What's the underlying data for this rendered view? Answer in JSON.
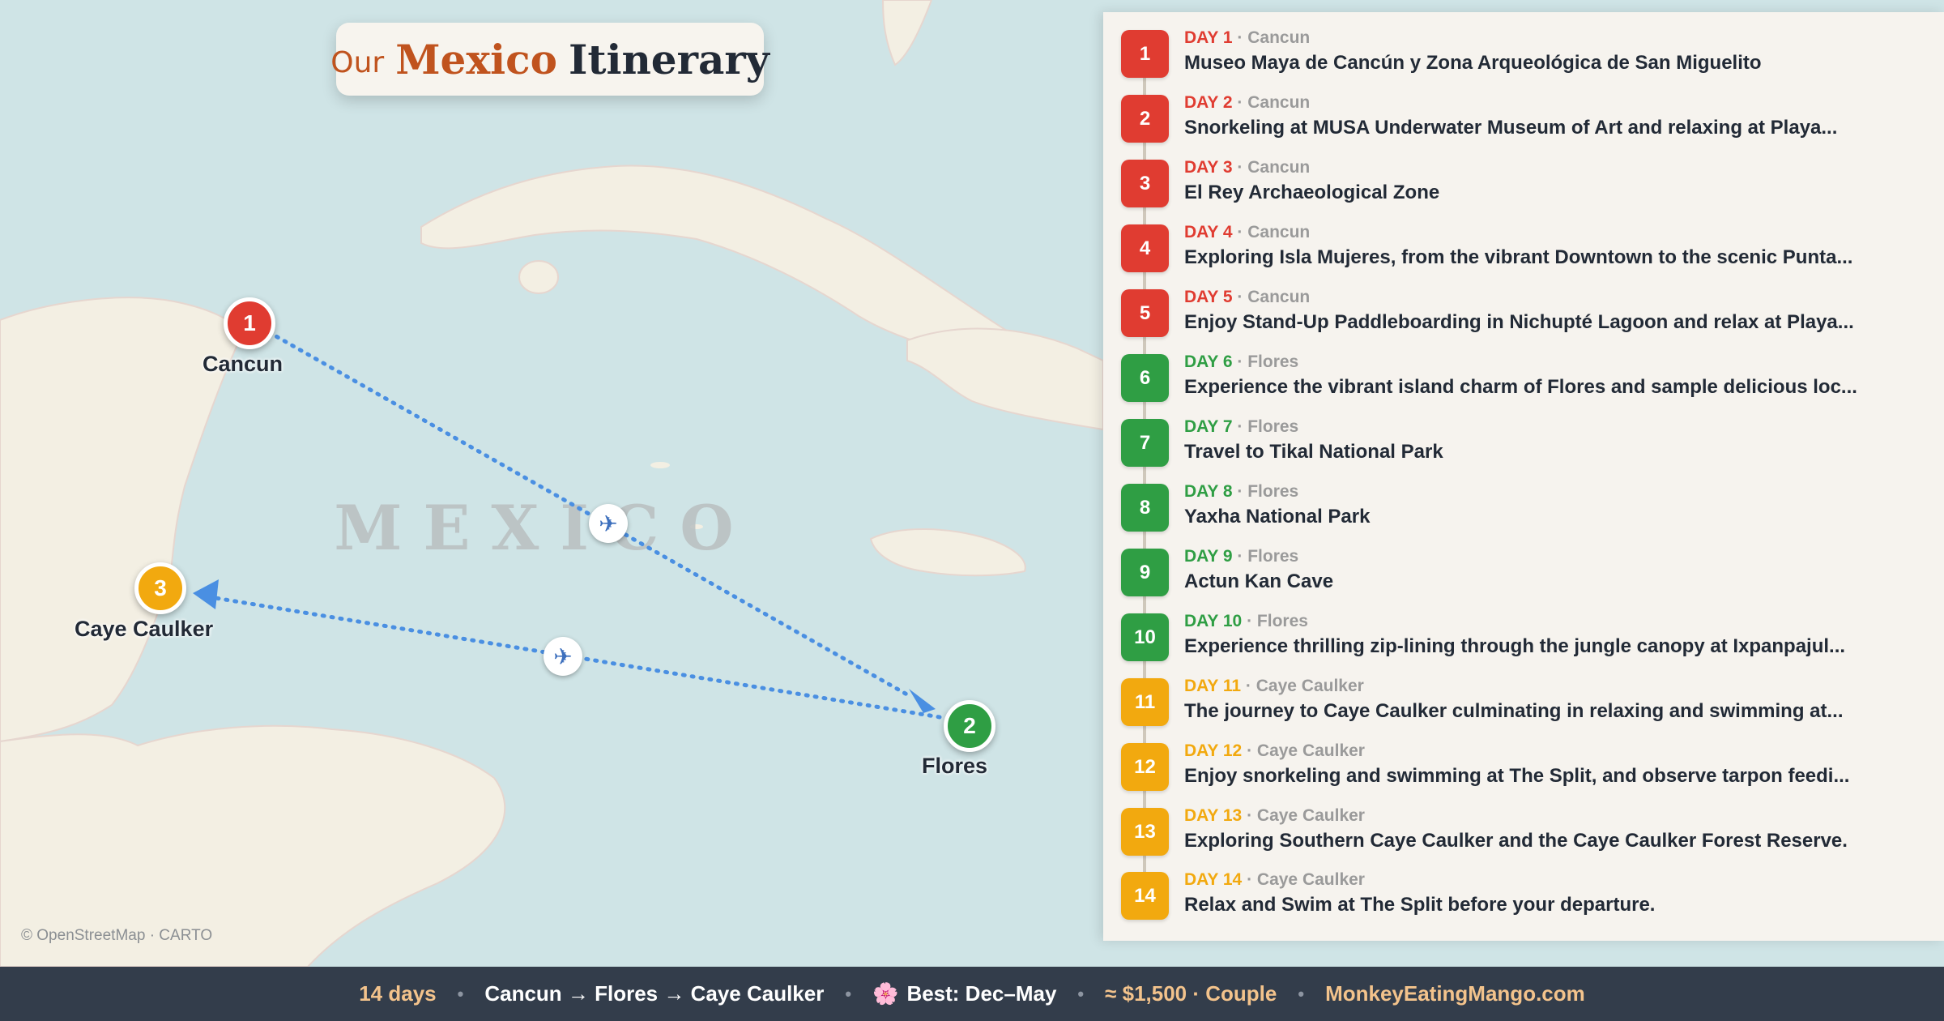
{
  "title": {
    "our": "Our",
    "mexico": "Mexico",
    "itinerary": "Itinerary"
  },
  "map": {
    "country_label": "MEXICO",
    "attribution": "© OpenStreetMap · CARTO",
    "route_color": "#4a8fe2",
    "stops": [
      {
        "num": "1",
        "name": "Cancun",
        "color": "#e03c31"
      },
      {
        "num": "2",
        "name": "Flores",
        "color": "#2f9e44"
      },
      {
        "num": "3",
        "name": "Caye Caulker",
        "color": "#f2a90f"
      }
    ],
    "plane_icon": "airplane-icon"
  },
  "colors": {
    "cancun": "#e03c31",
    "flores": "#2f9e44",
    "caye_caulker": "#f2a90f"
  },
  "days": [
    {
      "num": "1",
      "day": "DAY 1",
      "loc": "Cancun",
      "title": "Museo Maya de Cancún y Zona Arqueológica de San Miguelito"
    },
    {
      "num": "2",
      "day": "DAY 2",
      "loc": "Cancun",
      "title": "Snorkeling at MUSA Underwater Museum of Art and relaxing at Playa..."
    },
    {
      "num": "3",
      "day": "DAY 3",
      "loc": "Cancun",
      "title": "El Rey Archaeological Zone"
    },
    {
      "num": "4",
      "day": "DAY 4",
      "loc": "Cancun",
      "title": "Exploring Isla Mujeres, from the vibrant Downtown to the scenic Punta..."
    },
    {
      "num": "5",
      "day": "DAY 5",
      "loc": "Cancun",
      "title": "Enjoy Stand-Up Paddleboarding in Nichupté Lagoon and relax at Playa..."
    },
    {
      "num": "6",
      "day": "DAY 6",
      "loc": "Flores",
      "title": "Experience the vibrant island charm of Flores and sample delicious loc..."
    },
    {
      "num": "7",
      "day": "DAY 7",
      "loc": "Flores",
      "title": "Travel to Tikal National Park"
    },
    {
      "num": "8",
      "day": "DAY 8",
      "loc": "Flores",
      "title": "Yaxha National Park"
    },
    {
      "num": "9",
      "day": "DAY 9",
      "loc": "Flores",
      "title": "Actun Kan Cave"
    },
    {
      "num": "10",
      "day": "DAY 10",
      "loc": "Flores",
      "title": "Experience thrilling zip-lining through the jungle canopy at Ixpanpajul..."
    },
    {
      "num": "11",
      "day": "DAY 11",
      "loc": "Caye Caulker",
      "title": "The journey to Caye Caulker culminating in relaxing and swimming at..."
    },
    {
      "num": "12",
      "day": "DAY 12",
      "loc": "Caye Caulker",
      "title": "Enjoy snorkeling and swimming at The Split, and observe tarpon feedi..."
    },
    {
      "num": "13",
      "day": "DAY 13",
      "loc": "Caye Caulker",
      "title": "Exploring Southern Caye Caulker and the Caye Caulker Forest Reserve."
    },
    {
      "num": "14",
      "day": "DAY 14",
      "loc": "Caye Caulker",
      "title": "Relax and Swim at The Split before your departure."
    }
  ],
  "footer": {
    "duration": "14 days",
    "route": "Cancun → Flores → Caye Caulker",
    "best_icon": "🌸",
    "best": "Best: Dec–May",
    "budget": "≈ $1,500 · Couple",
    "site": "MonkeyEatingMango.com",
    "separator": "•"
  }
}
